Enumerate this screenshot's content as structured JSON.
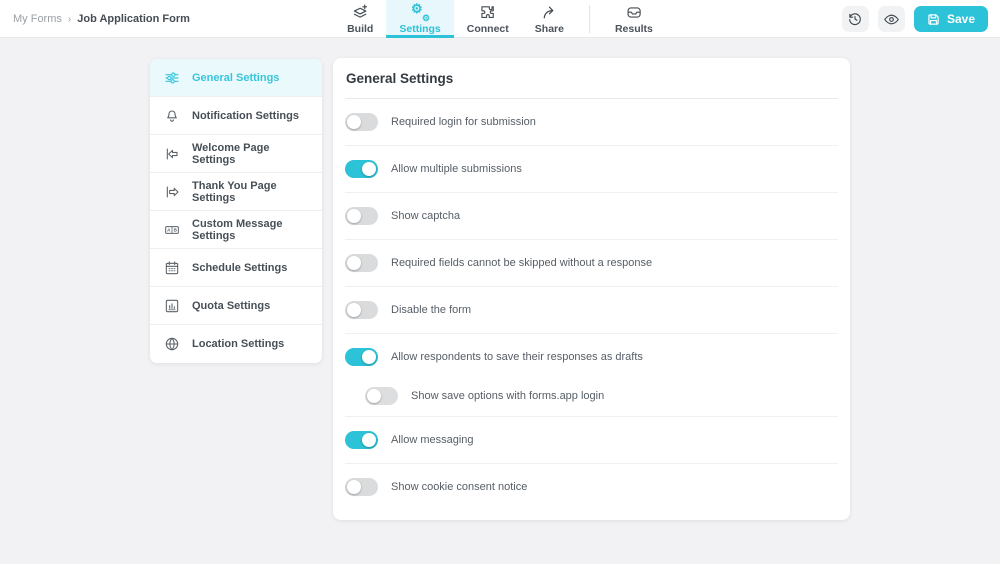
{
  "header": {
    "breadcrumb": {
      "parent": "My Forms",
      "separator": "›",
      "current": "Job Application Form"
    },
    "tabs": [
      {
        "label": "Build",
        "icon": "layers-plus-icon",
        "active": false
      },
      {
        "label": "Settings",
        "icon": "gears-icon",
        "active": true
      },
      {
        "label": "Connect",
        "icon": "puzzle-icon",
        "active": false
      },
      {
        "label": "Share",
        "icon": "share-arrow-icon",
        "active": false
      },
      {
        "label": "Results",
        "icon": "inbox-icon",
        "active": false
      }
    ],
    "actions": {
      "history_icon": "history-icon",
      "preview_icon": "eye-icon",
      "save_icon": "floppy-icon",
      "save_label": "Save"
    }
  },
  "sidebar": {
    "items": [
      {
        "label": "General Settings",
        "icon": "sliders-icon",
        "active": true
      },
      {
        "label": "Notification Settings",
        "icon": "bell-icon",
        "active": false
      },
      {
        "label": "Welcome Page Settings",
        "icon": "page-start-icon",
        "active": false
      },
      {
        "label": "Thank You Page Settings",
        "icon": "page-end-icon",
        "active": false
      },
      {
        "label": "Custom Message Settings",
        "icon": "ab-message-icon",
        "active": false
      },
      {
        "label": "Schedule Settings",
        "icon": "calendar-icon",
        "active": false
      },
      {
        "label": "Quota Settings",
        "icon": "chart-box-icon",
        "active": false
      },
      {
        "label": "Location Settings",
        "icon": "globe-icon",
        "active": false
      }
    ]
  },
  "main": {
    "title": "General Settings",
    "toggles": [
      {
        "label": "Required login for submission",
        "on": false
      },
      {
        "label": "Allow multiple submissions",
        "on": true
      },
      {
        "label": "Show captcha",
        "on": false
      },
      {
        "label": "Required fields cannot be skipped without a response",
        "on": false
      },
      {
        "label": "Disable the form",
        "on": false
      },
      {
        "label": "Allow respondents to save their responses as drafts",
        "on": true
      },
      {
        "label": "Show save options with forms.app login",
        "on": false,
        "indent": true
      },
      {
        "label": "Allow messaging",
        "on": true
      },
      {
        "label": "Show cookie consent notice",
        "on": false
      }
    ]
  },
  "colors": {
    "accent": "#2cc2d7",
    "accent_light_bg": "#e7f7fb",
    "sidebar_active_bg": "#e9f9fc",
    "toggle_off": "#d9dbdd",
    "page_bg": "#f2f2f4"
  }
}
